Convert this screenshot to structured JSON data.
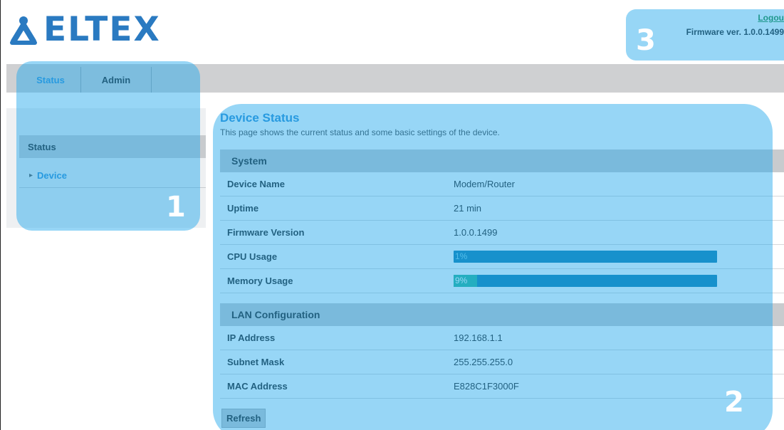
{
  "header": {
    "logo_text": "ELTEX",
    "logout_label": "Logou",
    "firmware_label": "Firmware ver. 1.0.0.1499"
  },
  "topnav": {
    "tabs": [
      {
        "label": "Status",
        "active": true
      },
      {
        "label": "Admin",
        "active": false
      }
    ]
  },
  "sidebar": {
    "section_title": "Status",
    "items": [
      {
        "label": "Device",
        "icon": "chevron-right-icon"
      }
    ]
  },
  "main": {
    "title": "Device Status",
    "description": "This page shows the current status and some basic settings of the device.",
    "sections": [
      {
        "title": "System",
        "rows": [
          {
            "label": "Device Name",
            "value": "Modem/Router"
          },
          {
            "label": "Uptime",
            "value": "21 min"
          },
          {
            "label": "Firmware Version",
            "value": "1.0.0.1499"
          },
          {
            "label": "CPU Usage",
            "value": "1%",
            "percent": 1
          },
          {
            "label": "Memory Usage",
            "value": "9%",
            "percent": 9
          }
        ]
      },
      {
        "title": "LAN Configuration",
        "rows": [
          {
            "label": "IP Address",
            "value": "192.168.1.1"
          },
          {
            "label": "Subnet Mask",
            "value": "255.255.255.0"
          },
          {
            "label": "MAC Address",
            "value": "E828C1F3000F"
          }
        ]
      }
    ],
    "refresh_label": "Refresh"
  },
  "annotations": [
    "1",
    "2",
    "3"
  ],
  "colors": {
    "accent": "#2d8fd5",
    "logo": "#2a7ac1",
    "bar_track": "#0e7eb0",
    "bar_fill": "#26b39a",
    "overlay": "#21a8eb"
  }
}
